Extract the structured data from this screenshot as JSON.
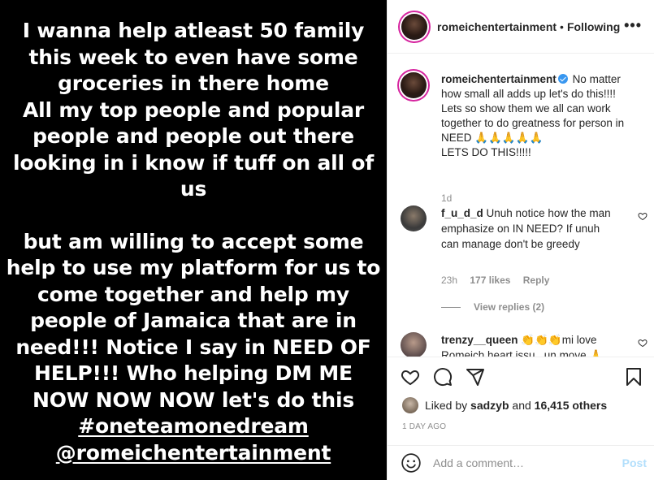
{
  "media": {
    "lines": [
      "I wanna help atleast 50 family",
      "this week to even have some",
      "groceries in there home",
      "All my top people and popular",
      "people and people out there",
      "looking in i know if tuff on all of",
      "us",
      "",
      "but am willing to accept some",
      "help to use my platform for us to",
      "come together and help my",
      "people of Jamaica that are in",
      "need!!! Notice I say in NEED OF",
      "HELP!!!  Who helping DM ME",
      "NOW NOW NOW let's do this",
      "#oneteamonedream",
      "@romeichentertainment"
    ]
  },
  "header": {
    "username": "romeichentertainment",
    "separator": "•",
    "follow_status": "Following",
    "more": "•••"
  },
  "caption": {
    "username": "romeichentertainment",
    "lines": [
      "No matter",
      "how small all adds up let's do this!!!!",
      "Lets so show them we all can work",
      "together to do greatness for person in",
      "NEED 🙏🙏🙏🙏🙏",
      "LETS DO THIS!!!!!"
    ],
    "time": "1d"
  },
  "comments": [
    {
      "username": "f_u_d_d",
      "text": "Unuh notice how the man emphasize on IN NEED? If unuh can manage don't be greedy",
      "time": "23h",
      "likes": "177 likes",
      "reply": "Reply",
      "view_replies": "View replies (2)"
    },
    {
      "username": "trenzy__queen",
      "text": "👏👏👏mi love",
      "text2": "Romeich heart issu...un move 🙏"
    }
  ],
  "actions": {
    "liked_by_prefix": "Liked by",
    "liked_by_user": "sadzyb",
    "and": "and",
    "others": "16,415 others",
    "post_time": "1 DAY AGO"
  },
  "add_comment": {
    "placeholder": "Add a comment…",
    "post_label": "Post"
  },
  "colors": {
    "media_bg": "#000000",
    "verified": "#3897f0",
    "muted": "#8e8e8e",
    "post_disabled": "#b2dffc"
  }
}
